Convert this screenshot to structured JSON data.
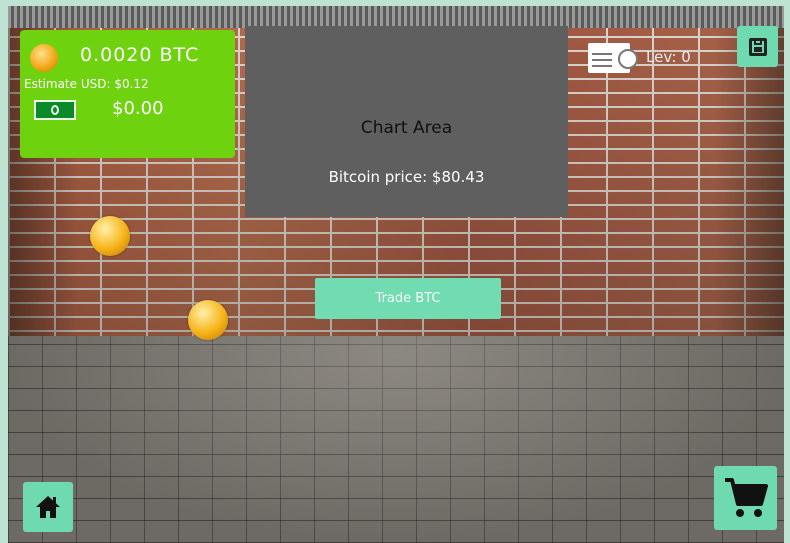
{
  "wallet": {
    "btc_amount": "0.0020 BTC",
    "usd_estimate": "Estimate USD: $0.12",
    "cash_amount": "$0.00"
  },
  "chart": {
    "title": "Chart Area",
    "price_text": "Bitcoin price: $80.43"
  },
  "level": {
    "text": "Lev: 0"
  },
  "actions": {
    "trade_label": "Trade BTC"
  },
  "icons": {
    "save": "save-icon",
    "home": "home-icon",
    "cart": "shopping-cart-icon",
    "coin": "bitcoin-coin-icon",
    "cash": "cash-icon",
    "level": "level-icon"
  },
  "colors": {
    "stats_panel": "#6fd20e",
    "chart_bg": "#5f5f5f",
    "button": "#6fd9b0"
  }
}
